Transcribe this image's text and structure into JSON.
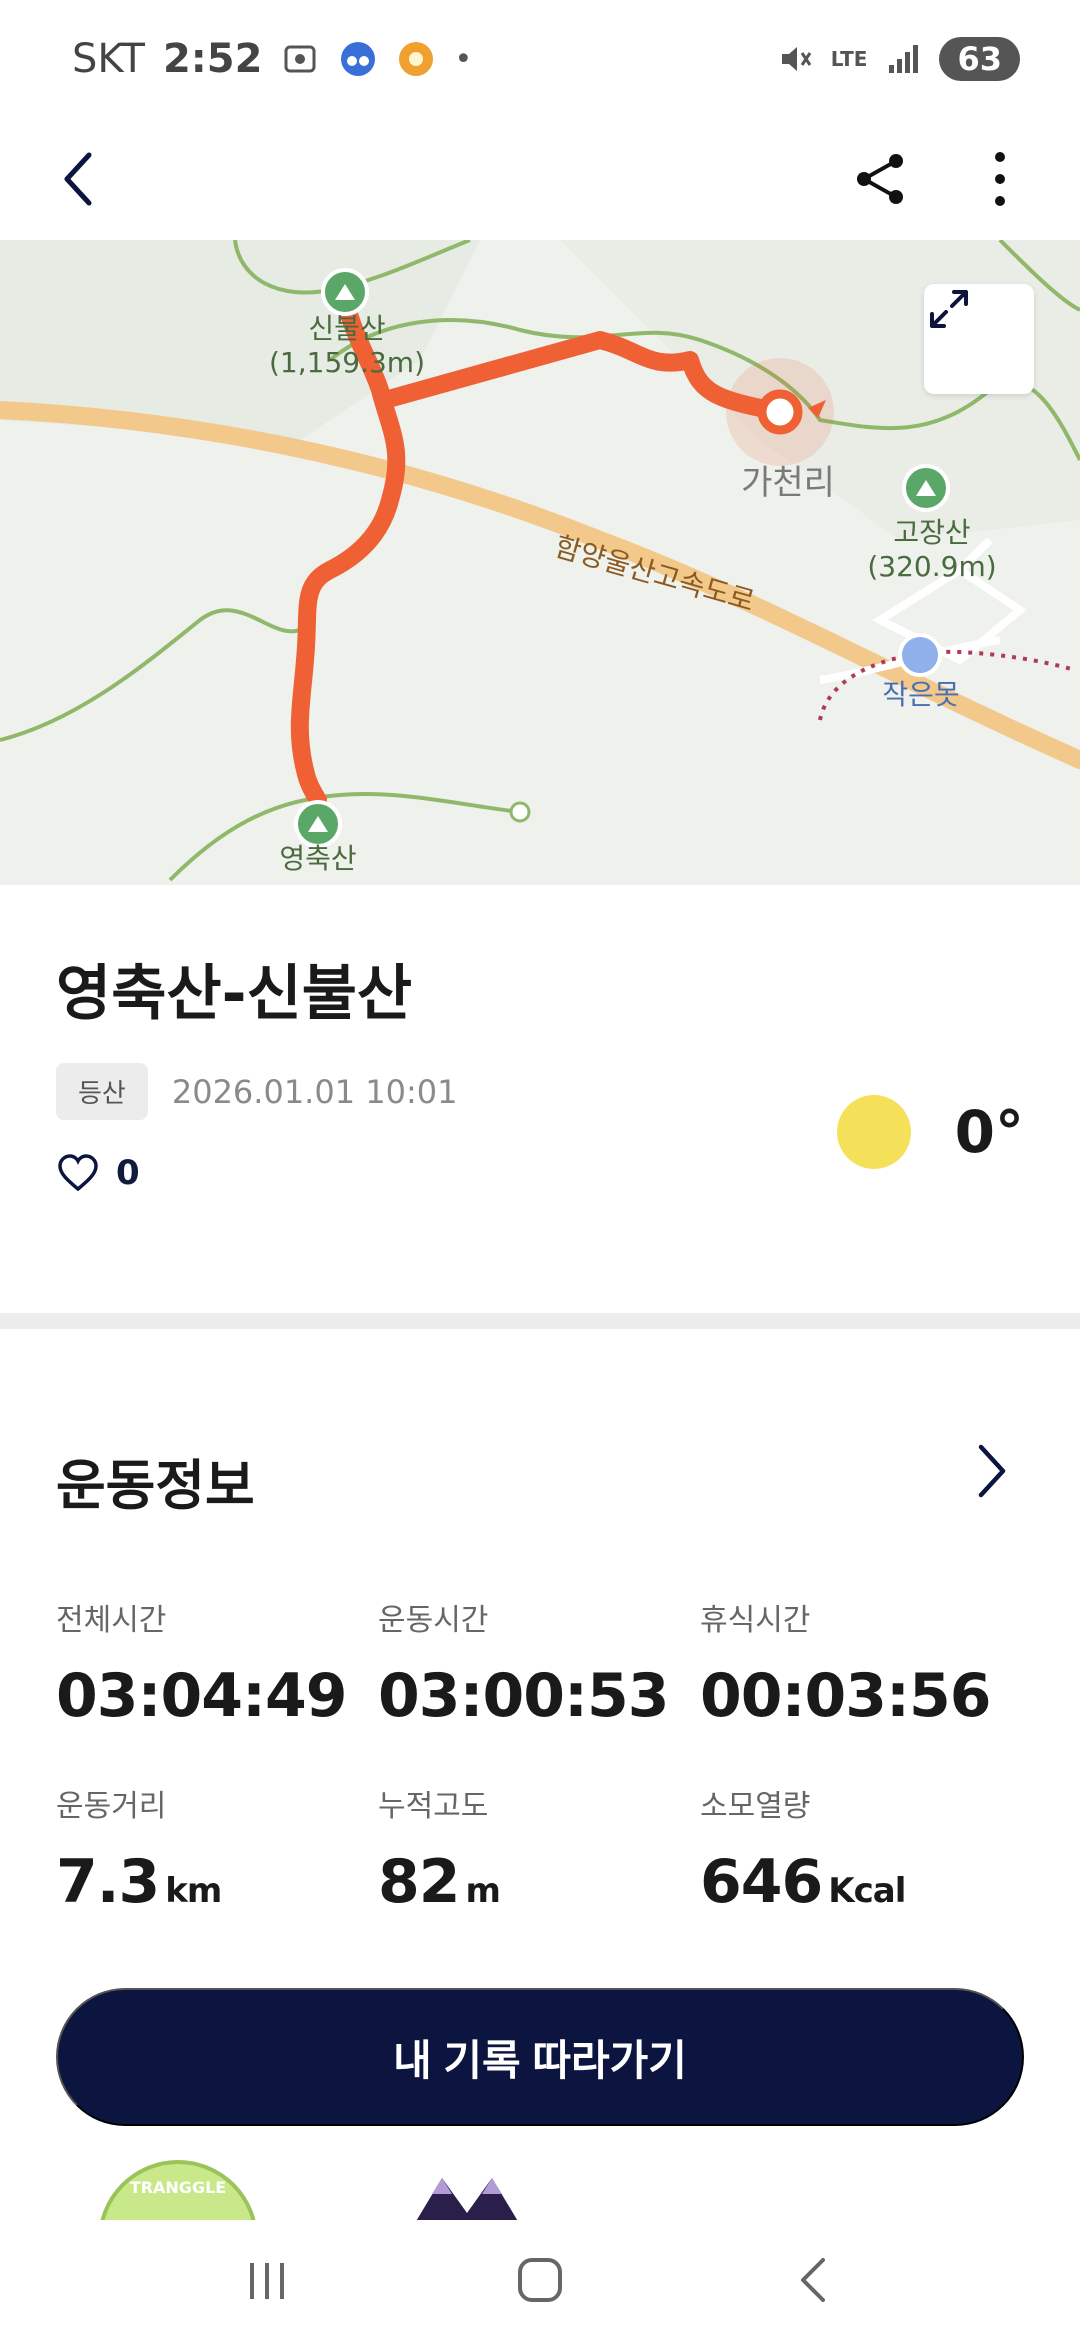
{
  "status_bar": {
    "carrier": "SKT",
    "time": "2:52",
    "network": "LTE",
    "battery": "63"
  },
  "map": {
    "labels": {
      "peak_sinbulsan": "신불산",
      "peak_sinbulsan_height": "(1,159.3m)",
      "village_gacheonri": "가천리",
      "peak_gojangsan": "고장산",
      "peak_gojangsan_height": "(320.9m)",
      "highway": "함양울산고속도로",
      "pond": "작은못",
      "peak_yeongchuksan": "영축산"
    },
    "colors": {
      "route": "#ef6135",
      "road": "#f3c98b",
      "trail": "#8fb86a"
    }
  },
  "activity": {
    "title": "영축산-신불산",
    "tag": "등산",
    "datetime": "2026.01.01 10:01",
    "likes": "0",
    "temperature": "0°"
  },
  "exercise": {
    "section_title": "운동정보",
    "stats": [
      {
        "label": "전체시간",
        "value": "03:04:49",
        "unit": ""
      },
      {
        "label": "운동시간",
        "value": "03:00:53",
        "unit": ""
      },
      {
        "label": "휴식시간",
        "value": "00:03:56",
        "unit": ""
      },
      {
        "label": "운동거리",
        "value": "7.3",
        "unit": "km"
      },
      {
        "label": "누적고도",
        "value": "82",
        "unit": "m"
      },
      {
        "label": "소모열량",
        "value": "646",
        "unit": "Kcal"
      }
    ]
  },
  "follow_button_label": "내 기록 따라가기",
  "badge_text": "TRANGGLE",
  "icons": [
    "back-icon",
    "share-icon",
    "more-icon",
    "expand-icon",
    "heart-icon",
    "chevron-right-icon",
    "recent-apps-icon",
    "home-icon",
    "nav-back-icon"
  ]
}
